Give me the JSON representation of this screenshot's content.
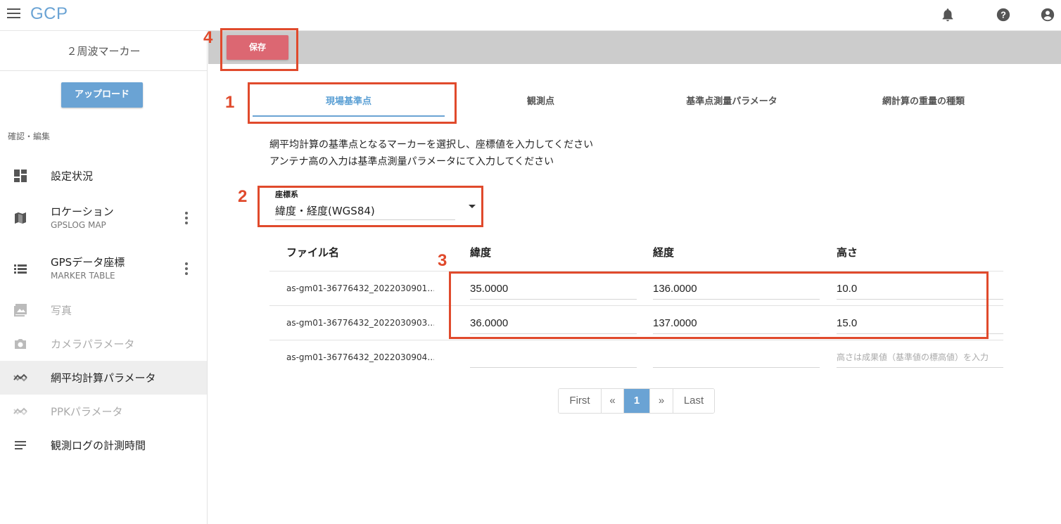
{
  "app": {
    "title": "GCP"
  },
  "sidebar": {
    "project_name": "２周波マーカー",
    "upload_label": "アップロード",
    "section_label": "確認・編集",
    "items": [
      {
        "label": "設定状況",
        "icon": "dashboard-icon"
      },
      {
        "label": "ロケーション",
        "sub": "GPSLOG MAP",
        "icon": "map-icon"
      },
      {
        "label": "GPSデータ座標",
        "sub": "MARKER TABLE",
        "icon": "list-icon"
      },
      {
        "label": "写真",
        "icon": "photo-icon",
        "disabled": true
      },
      {
        "label": "カメラパラメータ",
        "icon": "camera-icon",
        "disabled": true
      },
      {
        "label": "網平均計算パラメータ",
        "icon": "trend-icon",
        "active": true
      },
      {
        "label": "PPKパラメータ",
        "icon": "trend-icon",
        "disabled": true
      },
      {
        "label": "観測ログの計測時間",
        "icon": "notes-icon"
      }
    ]
  },
  "toolbar": {
    "save_label": "保存"
  },
  "tabs": [
    "現場基準点",
    "観測点",
    "基準点測量パラメータ",
    "網計算の重量の種類"
  ],
  "description": [
    "網平均計算の基準点となるマーカーを選択し、座標値を入力してください",
    "アンテナ高の入力は基準点測量パラメータにて入力してください"
  ],
  "coord_system": {
    "label": "座標系",
    "value": "緯度・経度(WGS84)"
  },
  "table": {
    "headers": [
      "ファイル名",
      "緯度",
      "経度",
      "高さ"
    ],
    "rows": [
      {
        "file": "as-gm01-36776432_2022030901…",
        "lat": "35.0000",
        "lon": "136.0000",
        "height": "10.0"
      },
      {
        "file": "as-gm01-36776432_2022030903…",
        "lat": "36.0000",
        "lon": "137.0000",
        "height": "15.0"
      },
      {
        "file": "as-gm01-36776432_2022030904…",
        "lat": "",
        "lon": "",
        "height": ""
      }
    ],
    "height_placeholder": "高さは成果値（基準値の標高値）を入力"
  },
  "pagination": {
    "first": "First",
    "prev": "«",
    "current": "1",
    "next": "»",
    "last": "Last"
  },
  "annotations": [
    "1",
    "2",
    "3",
    "4"
  ],
  "colors": {
    "accent": "#6aa3d4",
    "save": "#dc6772",
    "annotation": "#e04a2c"
  }
}
